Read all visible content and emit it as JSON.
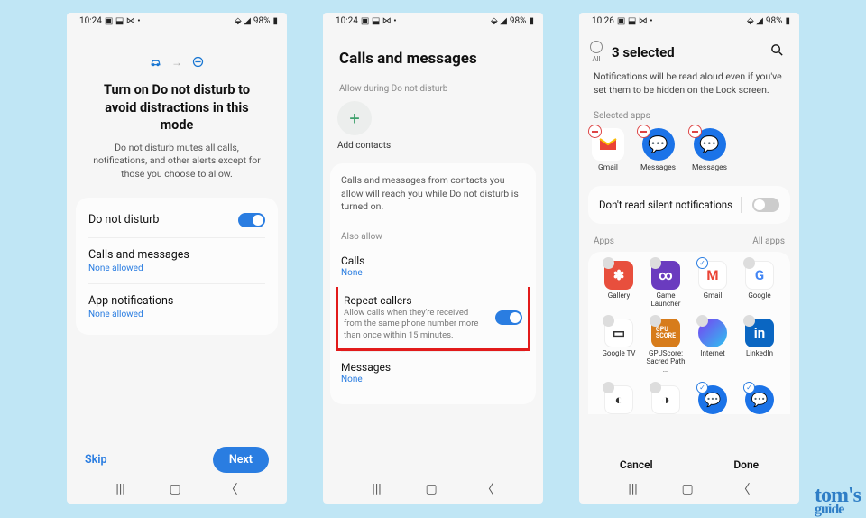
{
  "watermark": "tom's guide",
  "screens": [
    {
      "status": {
        "time": "10:24",
        "battery": "98%"
      },
      "title": "Turn on Do not disturb to avoid distractions in this mode",
      "subtitle": "Do not disturb mutes all calls, notifications, and other alerts except for those you choose to allow.",
      "dnd": {
        "label": "Do not disturb",
        "on": true
      },
      "calls": {
        "label": "Calls and messages",
        "sub": "None allowed"
      },
      "apps": {
        "label": "App notifications",
        "sub": "None allowed"
      },
      "skip": "Skip",
      "next": "Next"
    },
    {
      "status": {
        "time": "10:24",
        "battery": "98%"
      },
      "title": "Calls and messages",
      "allow_label": "Allow during Do not disturb",
      "add_contacts": "Add contacts",
      "info": "Calls and messages from contacts you allow will reach you while Do not disturb is turned on.",
      "also_allow": "Also allow",
      "rows": {
        "calls": {
          "label": "Calls",
          "sub": "None"
        },
        "repeat": {
          "label": "Repeat callers",
          "desc": "Allow calls when they're received from the same phone number more than once within 15 minutes.",
          "on": true
        },
        "messages": {
          "label": "Messages",
          "sub": "None"
        }
      }
    },
    {
      "status": {
        "time": "10:26",
        "battery": "98%"
      },
      "all": "All",
      "title": "3 selected",
      "note": "Notifications will be read aloud even if you've set them to be hidden on the Lock screen.",
      "selected_label": "Selected apps",
      "selected": [
        {
          "name": "Gmail"
        },
        {
          "name": "Messages"
        },
        {
          "name": "Messages"
        }
      ],
      "silent": {
        "label": "Don't read silent notifications",
        "on": false
      },
      "tabs": {
        "left": "Apps",
        "right": "All apps"
      },
      "grid": [
        {
          "name": "Gallery",
          "checked": false
        },
        {
          "name": "Game Launcher",
          "checked": false
        },
        {
          "name": "Gmail",
          "checked": true
        },
        {
          "name": "Google",
          "checked": false
        },
        {
          "name": "Google TV",
          "checked": false
        },
        {
          "name": "GPUScore: Sacred Path ...",
          "checked": false
        },
        {
          "name": "Internet",
          "checked": false
        },
        {
          "name": "LinkedIn",
          "checked": false
        }
      ],
      "cancel": "Cancel",
      "done": "Done"
    }
  ]
}
